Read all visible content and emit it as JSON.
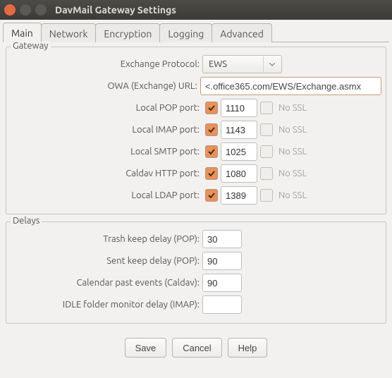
{
  "window": {
    "title": "DavMail Gateway Settings"
  },
  "tabs": {
    "main": "Main",
    "network": "Network",
    "encryption": "Encryption",
    "logging": "Logging",
    "advanced": "Advanced"
  },
  "gateway": {
    "title": "Gateway",
    "exchangeProtocolLabel": "Exchange Protocol:",
    "exchangeProtocolValue": "EWS",
    "owaLabel": "OWA (Exchange) URL:",
    "owaValue": "<.office365.com/EWS/Exchange.asmx",
    "popLabel": "Local POP port:",
    "popValue": "1110",
    "imapLabel": "Local IMAP port:",
    "imapValue": "1143",
    "smtpLabel": "Local SMTP port:",
    "smtpValue": "1025",
    "caldavLabel": "Caldav HTTP port:",
    "caldavValue": "1080",
    "ldapLabel": "Local LDAP port:",
    "ldapValue": "1389",
    "nossl": "No SSL"
  },
  "delays": {
    "title": "Delays",
    "trashLabel": "Trash keep delay (POP):",
    "trashValue": "30",
    "sentLabel": "Sent keep delay (POP):",
    "sentValue": "90",
    "calendarLabel": "Calendar past events (Caldav):",
    "calendarValue": "90",
    "idleLabel": "IDLE folder monitor delay (IMAP):",
    "idleValue": ""
  },
  "buttons": {
    "save": "Save",
    "cancel": "Cancel",
    "help": "Help"
  }
}
